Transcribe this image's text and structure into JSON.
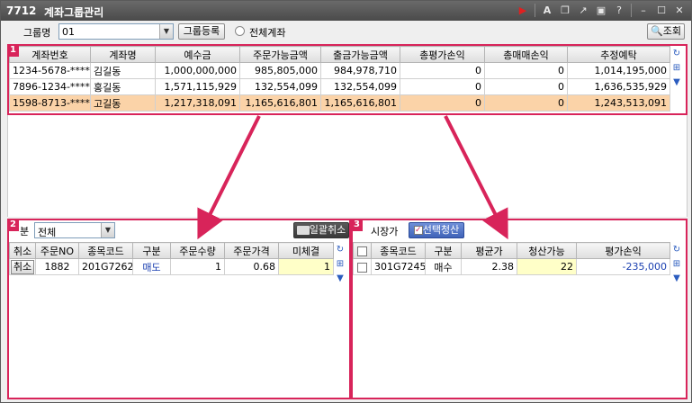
{
  "titlebar": {
    "code": "7712",
    "title": "계좌그룹관리"
  },
  "toolbar": {
    "group_label": "그룹명",
    "group_value": "01",
    "register_button": "그룹등록",
    "all_accounts_label": "전체계좌",
    "search_button": "조회"
  },
  "panel_badges": [
    "1",
    "2",
    "3"
  ],
  "accounts": {
    "columns": [
      "계좌번호",
      "계좌명",
      "예수금",
      "주문가능금액",
      "출금가능금액",
      "총평가손익",
      "총매매손익",
      "추정예탁"
    ],
    "rows": [
      [
        "1234-5678-****",
        "김길동",
        "1,000,000,000",
        "985,805,000",
        "984,978,710",
        "0",
        "0",
        "1,014,195,000"
      ],
      [
        "7896-1234-****",
        "홍길동",
        "1,571,115,929",
        "132,554,099",
        "132,554,099",
        "0",
        "0",
        "1,636,535,929"
      ],
      [
        "1598-8713-****",
        "고길동",
        "1,217,318,091",
        "1,165,616,801",
        "1,165,616,801",
        "0",
        "0",
        "1,243,513,091"
      ]
    ]
  },
  "orders": {
    "filter_label": "분",
    "filter_value": "전체",
    "cancel_all_button": "일괄취소",
    "columns": [
      "취소",
      "주문NO",
      "종목코드",
      "구분",
      "주문수량",
      "주문가격",
      "미체결"
    ],
    "rows": [
      {
        "cancel": "취소",
        "order_no": "1882",
        "code": "201G7262",
        "type": "매도",
        "qty": "1",
        "price": "0.68",
        "unfilled": "1"
      }
    ]
  },
  "positions": {
    "market_price_label": "시장가",
    "liquidate_button": "선택청산",
    "columns": [
      "종목코드",
      "구분",
      "평균가",
      "청산가능",
      "평가손익"
    ],
    "rows": [
      {
        "code": "301G7245",
        "type": "매수",
        "avg": "2.38",
        "available": "22",
        "pnl": "-235,000"
      }
    ]
  },
  "colors": {
    "accent": "#d8245a",
    "selected_row": "#fbd3a8",
    "highlight": "#ffffc8"
  }
}
